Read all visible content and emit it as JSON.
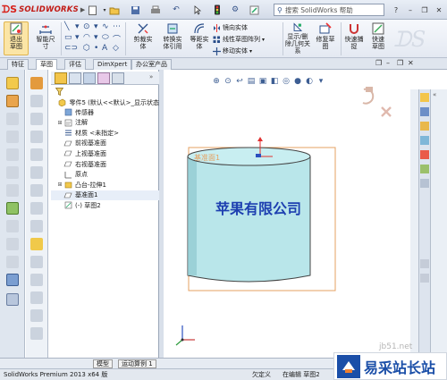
{
  "titlebar": {
    "logo_text": "SOLIDWORKS",
    "search_placeholder": "搜索 SolidWorks 帮助"
  },
  "ribbon": {
    "exit_sketch": "退出草图",
    "smart_dimension": "智能尺寸",
    "cut_solid": "剪裁实体",
    "convert_entities": "转换实体引用",
    "offset_entities": "等距实体",
    "mirror_entities": "镜向实体",
    "linear_pattern": "线性草图阵列",
    "move_entities": "移动实体",
    "show_delete_relations": "显示/删除几何关系",
    "repair_sketch": "修复草图",
    "quick_snaps": "快速捕捉",
    "rapid_sketch": "快速草图"
  },
  "command_tabs": [
    "特征",
    "草图",
    "评估",
    "DimXpert",
    "办公室产品"
  ],
  "feature_tree": {
    "root": "零件5 (默认<<默认>_显示状态",
    "items": [
      {
        "label": "传感器",
        "icon": "sensor-icon",
        "expandable": false
      },
      {
        "label": "注解",
        "icon": "annotation-icon",
        "expandable": true
      },
      {
        "label": "材质 <未指定>",
        "icon": "material-icon",
        "expandable": false
      },
      {
        "label": "前视基准面",
        "icon": "plane-icon",
        "expandable": false
      },
      {
        "label": "上视基准面",
        "icon": "plane-icon",
        "expandable": false
      },
      {
        "label": "右视基准面",
        "icon": "plane-icon",
        "expandable": false
      },
      {
        "label": "原点",
        "icon": "origin-icon",
        "expandable": false
      },
      {
        "label": "凸台-拉伸1",
        "icon": "extrude-icon",
        "expandable": true
      },
      {
        "label": "基准面1",
        "icon": "plane-icon",
        "expandable": false
      },
      {
        "label": "(-) 草图2",
        "icon": "sketch-icon",
        "expandable": false
      }
    ]
  },
  "viewport": {
    "plane_label": "基准面1",
    "sketch_text": "苹果有限公司"
  },
  "bottom_tabs": [
    "模型",
    "运动算例 1"
  ],
  "status": {
    "product": "SolidWorks Premium 2013 x64 版",
    "constraint": "欠定义",
    "editing": "在编辑 草图2"
  },
  "watermark": {
    "site": "jb51.net",
    "text": "易采站长站"
  },
  "colors": {
    "accent": "#1b4fa8",
    "cylinder_fill": "#b9e6ea",
    "plane_border": "#e6a060",
    "sketch_text": "#1d3fb0"
  }
}
